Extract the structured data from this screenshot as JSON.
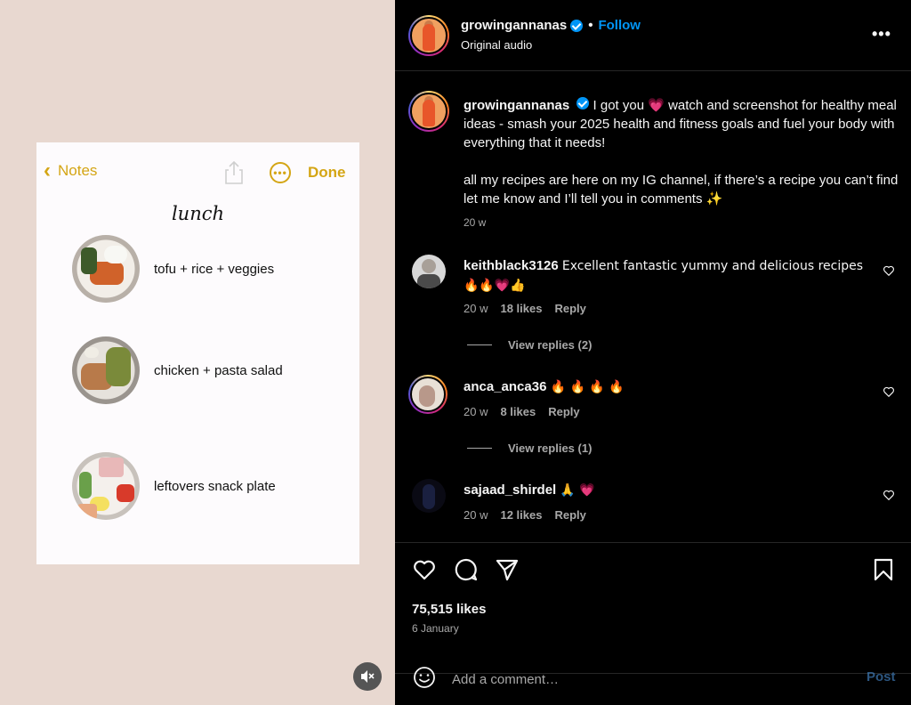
{
  "post": {
    "username": "growingannanas",
    "follow_label": "Follow",
    "separator": "•",
    "audio": "Original audio",
    "more_label": "•••"
  },
  "media": {
    "note": {
      "back_label": "Notes",
      "done_label": "Done",
      "title": "lunch",
      "meals": [
        {
          "label": "tofu + rice + veggies"
        },
        {
          "label": "chicken + pasta salad"
        },
        {
          "label": "leftovers snack plate"
        }
      ]
    }
  },
  "caption": {
    "username": "growingannanas",
    "text": "I got you 💗 watch and screenshot for healthy meal ideas - smash your 2025 health and fitness goals and fuel your body with everything that it needs!",
    "text2": "all my recipes are here on my IG channel, if there’s a recipe you can’t find let me know and I’ll tell you in comments ✨",
    "time": "20 w"
  },
  "comments": [
    {
      "username": "keithblack3126",
      "text": "Excellent fantastic yummy and delicious recipes 🔥🔥💗👍",
      "time": "20 w",
      "likes": "18 likes",
      "reply": "Reply",
      "view_replies": "View replies (2)"
    },
    {
      "username": "anca_anca36",
      "text": "🔥 🔥 🔥 🔥",
      "time": "20 w",
      "likes": "8 likes",
      "reply": "Reply",
      "view_replies": "View replies (1)"
    },
    {
      "username": "sajaad_shirdel",
      "text": "🙏 💗",
      "time": "20 w",
      "likes": "12 likes",
      "reply": "Reply"
    }
  ],
  "stats": {
    "likes": "75,515 likes",
    "date": "6 January"
  },
  "add_comment": {
    "placeholder": "Add a comment…",
    "post_label": "Post"
  },
  "colors": {
    "accent": "#0095f6",
    "notes_yellow": "#d4a514",
    "background": "#000000",
    "media_bg": "#e8d8d0"
  }
}
